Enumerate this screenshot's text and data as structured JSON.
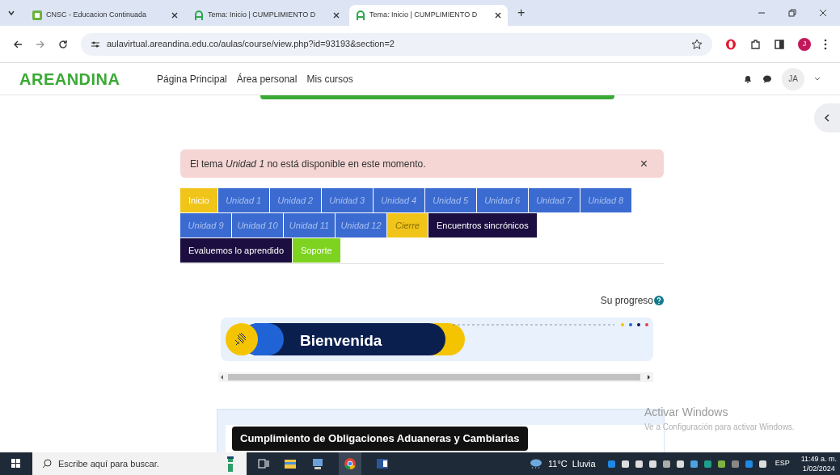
{
  "browser": {
    "tabs": [
      {
        "title": "CNSC - Educacion Continuada",
        "selected": false
      },
      {
        "title": "Tema: Inicio | CUMPLIMIENTO D",
        "selected": false
      },
      {
        "title": "Tema: Inicio | CUMPLIMIENTO D",
        "selected": true
      }
    ],
    "new_tab": "+",
    "url": "aulavirtual.areandina.edu.co/aulas/course/view.php?id=93193&section=2",
    "profile": "J"
  },
  "site": {
    "logo": "AREANDINA",
    "nav": [
      "Página Principal",
      "Área personal",
      "Mis cursos"
    ],
    "user": "JA"
  },
  "alert": {
    "text": "El tema *Unidad 1* no está disponible en este momento.",
    "close": "×"
  },
  "sections": [
    [
      {
        "label": "Inicio",
        "kind": "highlight",
        "disabled": false
      },
      {
        "label": "Unidad 1",
        "kind": "unit",
        "disabled": true
      },
      {
        "label": "Unidad 2",
        "kind": "unit",
        "disabled": true
      },
      {
        "label": "Unidad 3",
        "kind": "unit",
        "disabled": true
      },
      {
        "label": "Unidad 4",
        "kind": "unit",
        "disabled": true
      },
      {
        "label": "Unidad 5",
        "kind": "unit",
        "disabled": true
      },
      {
        "label": "Unidad 6",
        "kind": "unit",
        "disabled": true
      },
      {
        "label": "Unidad 7",
        "kind": "unit",
        "disabled": true
      },
      {
        "label": "Unidad 8",
        "kind": "unit",
        "disabled": true
      }
    ],
    [
      {
        "label": "Unidad 9",
        "kind": "unit",
        "disabled": true
      },
      {
        "label": "Unidad 10",
        "kind": "unit",
        "disabled": true
      },
      {
        "label": "Unidad 11",
        "kind": "unit",
        "disabled": true
      },
      {
        "label": "Unidad 12",
        "kind": "unit",
        "disabled": true
      },
      {
        "label": "Cierre",
        "kind": "highlight",
        "disabled": true
      },
      {
        "label": "Encuentros sincrónicos",
        "kind": "dark",
        "disabled": false
      }
    ],
    [
      {
        "label": "Evaluemos lo aprendido",
        "kind": "dark",
        "disabled": false
      },
      {
        "label": "Soporte",
        "kind": "support",
        "disabled": false
      }
    ]
  ],
  "progress_label": "Su progreso",
  "banner": {
    "title": "Bienvenida"
  },
  "course_title": "Cumplimiento de Obligaciones Aduaneras y Cambiarias",
  "activation": {
    "title": "Activar Windows",
    "text": "Ve a Configuración para activar Windows."
  },
  "taskbar": {
    "search": "Escribe aquí para buscar.",
    "weather": "11°C  Lluvia",
    "language": "ESP",
    "time": "11:49 a. m.",
    "date": "1/02/2024"
  }
}
